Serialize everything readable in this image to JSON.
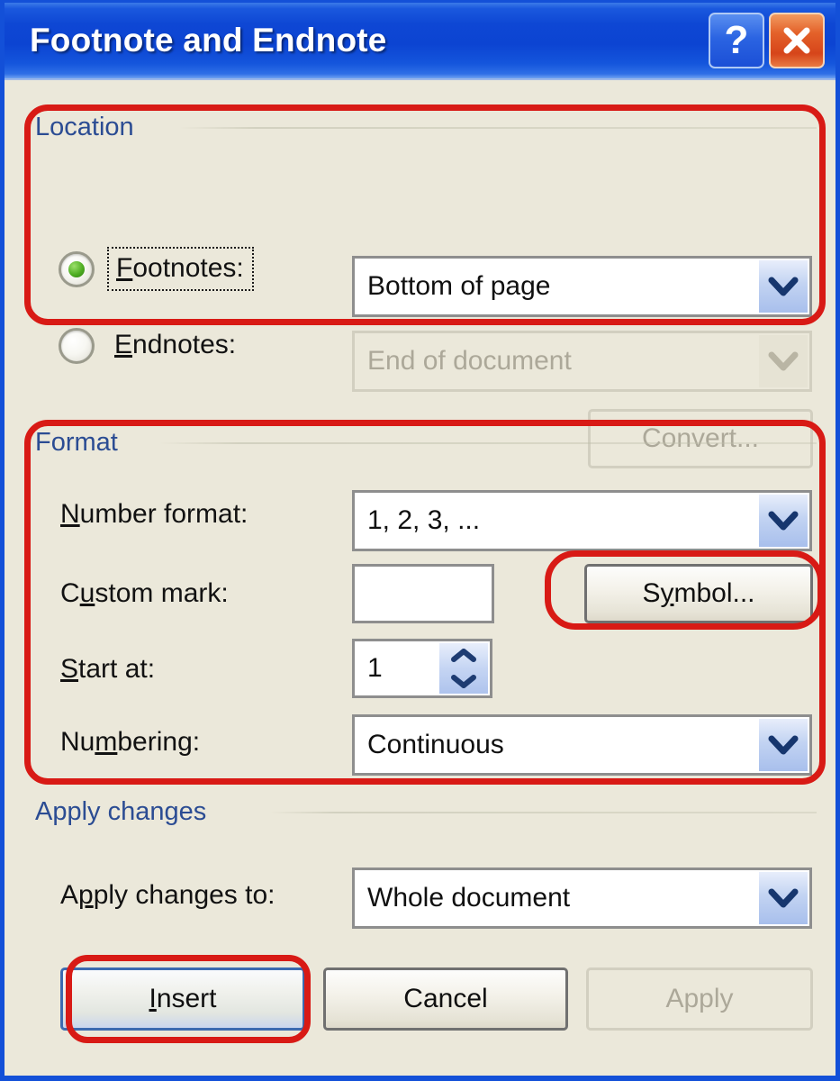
{
  "window": {
    "title": "Footnote and Endnote",
    "help_button_label": "?",
    "close_button_label": "X",
    "accent_titlebar": "#0C44D2",
    "accent_body": "#EBE8DA",
    "annotation_color": "#D81A15"
  },
  "location_group": {
    "label": "Location",
    "footnotes": {
      "radio_label": "Footnotes:",
      "access_key": "F",
      "selected": true,
      "focused": true,
      "dropdown_value": "Bottom of page",
      "dropdown_enabled": true
    },
    "endnotes": {
      "radio_label": "Endnotes:",
      "access_key": "E",
      "selected": false,
      "focused": false,
      "dropdown_value": "End of document",
      "dropdown_enabled": false
    },
    "convert_button": {
      "label": "Convert...",
      "enabled": false
    }
  },
  "format_group": {
    "label": "Format",
    "number_format": {
      "label": "Number format:",
      "access_key": "N",
      "value": "1, 2, 3, ..."
    },
    "custom_mark": {
      "label": "Custom mark:",
      "access_key": "u",
      "value": "",
      "placeholder": ""
    },
    "symbol_button": {
      "label": "Symbol...",
      "access_key": "y",
      "enabled": true
    },
    "start_at": {
      "label": "Start at:",
      "access_key": "S",
      "value": "1"
    },
    "numbering": {
      "label": "Numbering:",
      "access_key": "m",
      "value": "Continuous"
    }
  },
  "apply_changes_group": {
    "label": "Apply changes",
    "apply_to": {
      "label": "Apply changes to:",
      "access_key": "p",
      "value": "Whole document"
    }
  },
  "footer_buttons": {
    "insert": {
      "label": "Insert",
      "access_key": "I",
      "default": true,
      "enabled": true
    },
    "cancel": {
      "label": "Cancel",
      "default": false,
      "enabled": true
    },
    "apply": {
      "label": "Apply",
      "default": false,
      "enabled": false
    }
  }
}
